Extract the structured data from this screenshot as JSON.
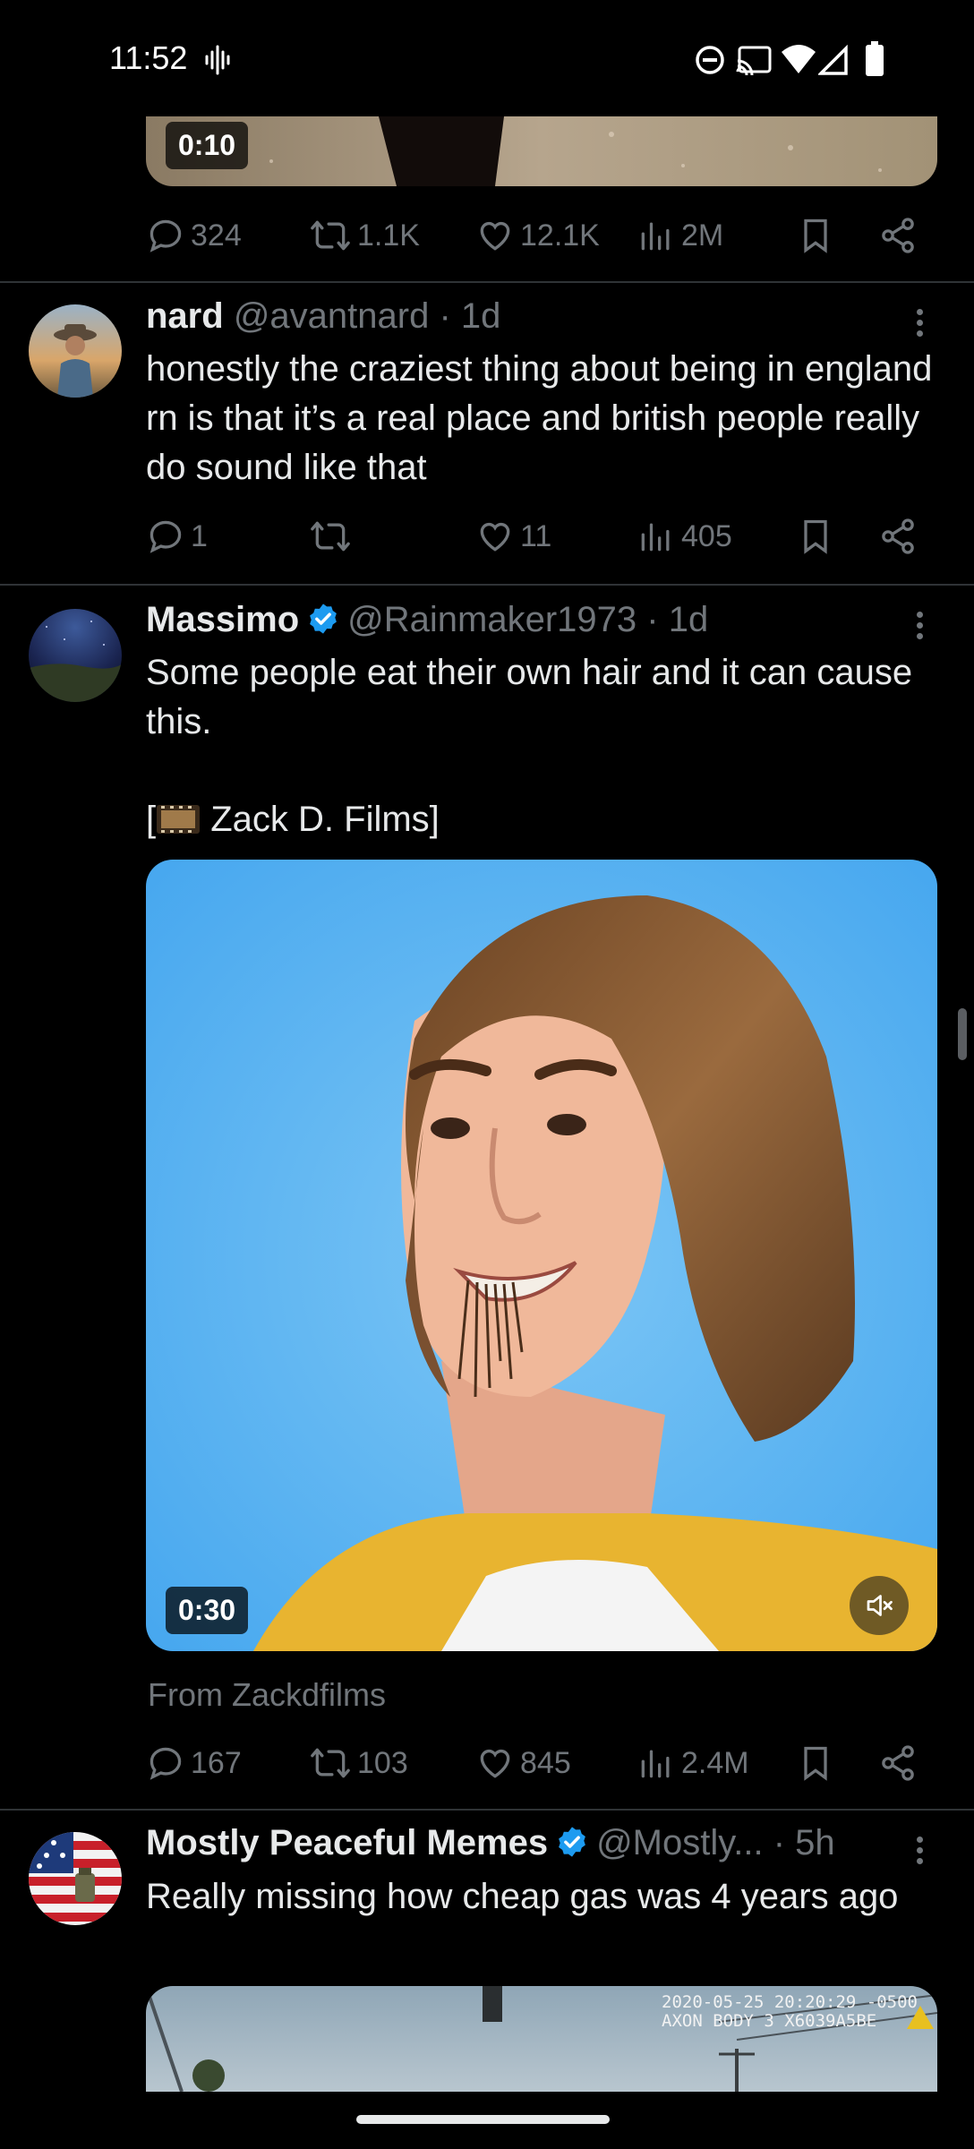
{
  "status_bar": {
    "time": "11:52",
    "icons": [
      "voice-activity-icon",
      "do-not-disturb-icon",
      "cast-icon",
      "wifi-icon",
      "signal-icon",
      "battery-icon"
    ]
  },
  "tweets": [
    {
      "media_duration": "0:10",
      "actions": {
        "replies": "324",
        "retweets": "1.1K",
        "likes": "12.1K",
        "views": "2M"
      }
    },
    {
      "name": "nard",
      "handle": "@avantnard",
      "age": "· 1d",
      "text": "honestly the craziest thing about being in england rn is that it’s a real place and british people really do sound like that",
      "actions": {
        "replies": "1",
        "retweets": "",
        "likes": "11",
        "views": "405"
      }
    },
    {
      "name": "Massimo",
      "verified": true,
      "handle": "@Rainmaker1973",
      "age": "· 1d",
      "text": "Some people eat their own hair and it can cause this.",
      "credit_prefix": "[",
      "credit_text": " Zack D. Films]",
      "media_duration": "0:30",
      "source": "From Zackdfilms",
      "actions": {
        "replies": "167",
        "retweets": "103",
        "likes": "845",
        "views": "2.4M"
      }
    },
    {
      "name": "Mostly Peaceful Memes",
      "verified": true,
      "handle": "@Mostly...",
      "age": "· 5h",
      "text": "Really missing how cheap gas was 4 years ago",
      "media_overlay_line1": "2020-05-25 20:20:29 -0500",
      "media_overlay_line2": "AXON BODY 3 X6039A5BE"
    }
  ],
  "colors": {
    "background": "#000000",
    "text": "#e7e9ea",
    "muted": "#71767b",
    "verified": "#1d9bf0",
    "divider": "#2f3336"
  }
}
